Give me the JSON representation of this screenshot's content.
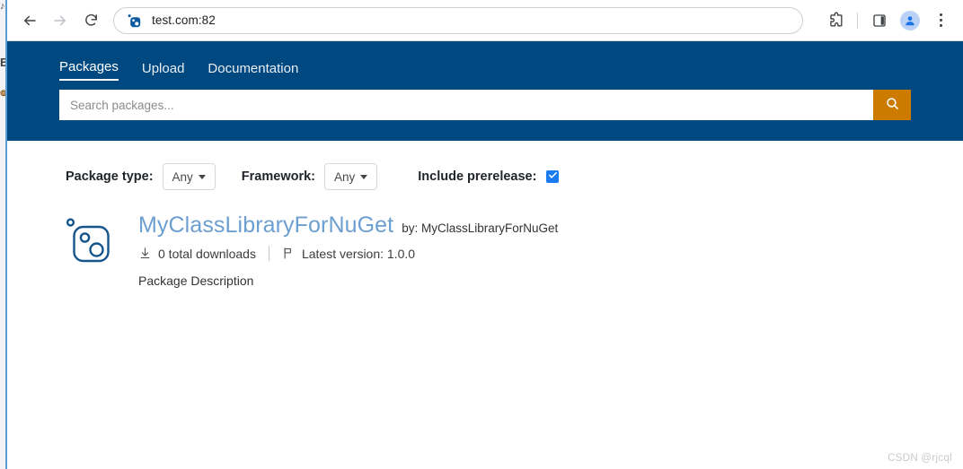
{
  "browser": {
    "back_tooltip": "Back",
    "forward_tooltip": "Forward",
    "reload_tooltip": "Reload",
    "url": "test.com:82",
    "favicon_name": "nuget-favicon",
    "extensions_tooltip": "Extensions",
    "side_panel_tooltip": "Side panel",
    "profile_tooltip": "Profile",
    "menu_tooltip": "Customize and control Google Chrome"
  },
  "background_text": {
    "glyph_top": "♪",
    "glyph_one": "E",
    "glyph_two": "๏"
  },
  "site": {
    "nav": [
      {
        "label": "Packages",
        "active": true
      },
      {
        "label": "Upload",
        "active": false
      },
      {
        "label": "Documentation",
        "active": false
      }
    ],
    "search": {
      "placeholder": "Search packages...",
      "value": "",
      "button_icon": "search-icon"
    },
    "colors": {
      "header_blue": "#004880",
      "search_button_orange": "#cc7a00",
      "link_blue": "#6c9fd1",
      "checkbox_blue": "#1a7cf0"
    }
  },
  "filters": {
    "package_type_label": "Package type:",
    "package_type_value": "Any",
    "framework_label": "Framework:",
    "framework_value": "Any",
    "prerelease_label": "Include prerelease:",
    "prerelease_checked": true
  },
  "results": [
    {
      "icon": "nuget-package-icon",
      "title": "MyClassLibraryForNuGet",
      "author": "by: MyClassLibraryForNuGet",
      "downloads": "0 total downloads",
      "downloads_icon": "download-icon",
      "version": "Latest version: 1.0.0",
      "version_icon": "flag-icon",
      "description": "Package Description"
    }
  ],
  "watermark": "CSDN @rjcql"
}
